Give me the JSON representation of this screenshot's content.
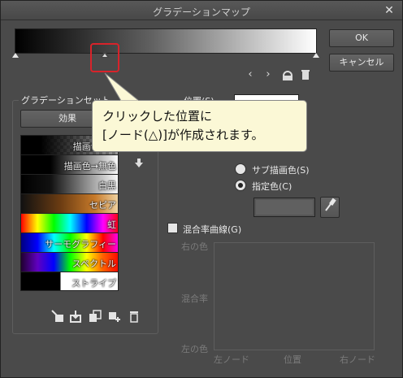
{
  "window": {
    "title": "グラデーションマップ",
    "close_icon": "close-icon"
  },
  "buttons": {
    "ok": "OK",
    "cancel": "キャンセル",
    "effect": "効果"
  },
  "gradient_set": {
    "label": "グラデーションセット",
    "presets": [
      {
        "label": "描画色→透"
      },
      {
        "label": "描画色→無色"
      },
      {
        "label": "白黒"
      },
      {
        "label": "セピア"
      },
      {
        "label": "虹"
      },
      {
        "label": "サーモグラフィー"
      },
      {
        "label": "スペクトル"
      },
      {
        "label": "ストライプ"
      }
    ]
  },
  "node_settings": {
    "position_label": "位置(S)",
    "position_value": "",
    "radio_options": [
      {
        "label": "サブ描画色(S)",
        "checked": false
      },
      {
        "label": "指定色(C)",
        "checked": true
      }
    ],
    "specified_color": "#606060"
  },
  "blend_curve": {
    "checkbox_label": "混合率曲線(G)",
    "checked": false,
    "y_top": "右の色",
    "y_mid": "混合率",
    "y_bottom": "左の色",
    "x_left": "左ノード",
    "x_mid": "位置",
    "x_right": "右ノード"
  },
  "callout": {
    "line1": "クリックした位置に",
    "line2": "[ノード(△)]が作成されます。"
  },
  "colors": {
    "highlight": "#d8232a",
    "callout_bg": "#fbf8d6"
  }
}
